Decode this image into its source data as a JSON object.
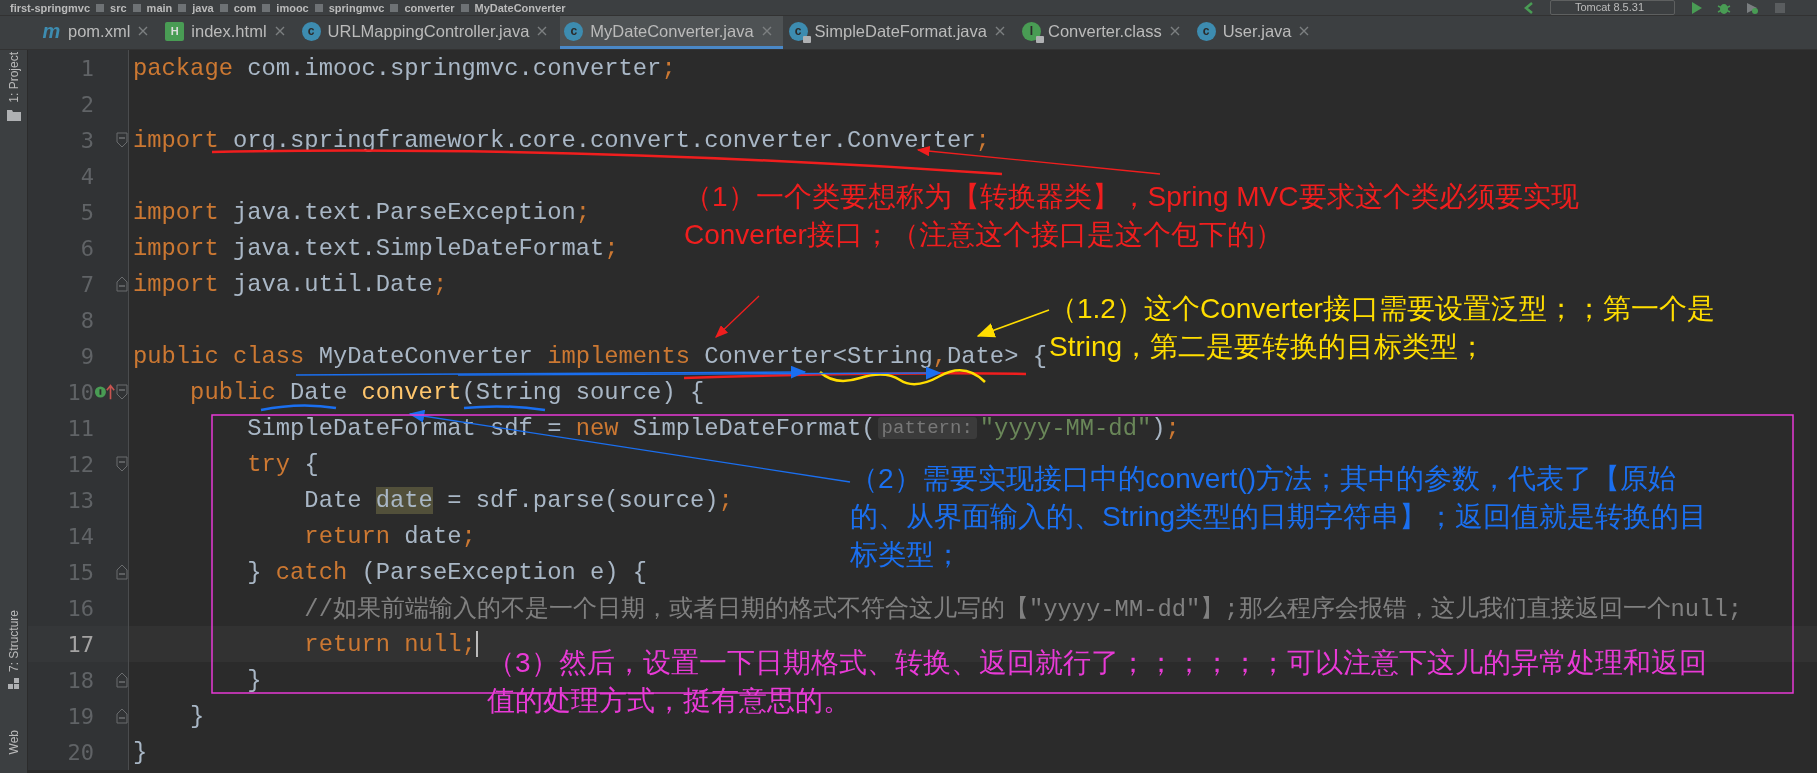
{
  "breadcrumbs": [
    "first-springmvc",
    "src",
    "main",
    "java",
    "com",
    "imooc",
    "springmvc",
    "converter",
    "MyDateConverter"
  ],
  "run_config": "Tomcat 8.5.31",
  "tabs": [
    {
      "label": "pom.xml",
      "badge": "m",
      "kind": "maven",
      "locked": false,
      "selected": false
    },
    {
      "label": "index.html",
      "badge": "H",
      "kind": "html",
      "locked": false,
      "selected": false
    },
    {
      "label": "URLMappingController.java",
      "badge": "c",
      "kind": "class",
      "locked": false,
      "selected": false
    },
    {
      "label": "MyDateConverter.java",
      "badge": "c",
      "kind": "class",
      "locked": false,
      "selected": true
    },
    {
      "label": "SimpleDateFormat.java",
      "badge": "c",
      "kind": "class",
      "locked": true,
      "selected": false
    },
    {
      "label": "Converter.class",
      "badge": "I",
      "kind": "interface",
      "locked": true,
      "selected": false
    },
    {
      "label": "User.java",
      "badge": "c",
      "kind": "class",
      "locked": false,
      "selected": false
    }
  ],
  "side_tools": [
    {
      "label": "1: Project",
      "kind": "project"
    },
    {
      "label": "7: Structure",
      "kind": "structure"
    },
    {
      "label": "Web",
      "kind": "web"
    }
  ],
  "lines": [
    {
      "n": "1",
      "current": false,
      "fold_start": false,
      "fold_end": false,
      "implements_marker": false,
      "segs": [
        {
          "kind": "keyword",
          "t": "package"
        },
        {
          "kind": "plain",
          "t": " com.imooc.springmvc.converter"
        },
        {
          "kind": "keyword",
          "t": ";"
        }
      ]
    },
    {
      "n": "2",
      "current": false,
      "fold_start": false,
      "fold_end": false,
      "implements_marker": false
    },
    {
      "n": "3",
      "current": false,
      "fold_start": true,
      "fold_end": false,
      "implements_marker": false,
      "segs": [
        {
          "kind": "keyword",
          "t": "import"
        },
        {
          "kind": "plain",
          "t": " org.springframework.core.convert.converter.Converter"
        },
        {
          "kind": "keyword",
          "t": ";"
        }
      ]
    },
    {
      "n": "4",
      "current": false,
      "fold_start": false,
      "fold_end": false,
      "implements_marker": false
    },
    {
      "n": "5",
      "current": false,
      "fold_start": false,
      "fold_end": false,
      "implements_marker": false,
      "segs": [
        {
          "kind": "keyword",
          "t": "import"
        },
        {
          "kind": "plain",
          "t": " java.text.ParseException"
        },
        {
          "kind": "keyword",
          "t": ";"
        }
      ]
    },
    {
      "n": "6",
      "current": false,
      "fold_start": false,
      "fold_end": false,
      "implements_marker": false,
      "segs": [
        {
          "kind": "keyword",
          "t": "import"
        },
        {
          "kind": "plain",
          "t": " java.text.SimpleDateFormat"
        },
        {
          "kind": "keyword",
          "t": ";"
        }
      ]
    },
    {
      "n": "7",
      "current": false,
      "fold_start": false,
      "fold_end": true,
      "implements_marker": false,
      "segs": [
        {
          "kind": "keyword",
          "t": "import"
        },
        {
          "kind": "plain",
          "t": " java.util.Date"
        },
        {
          "kind": "keyword",
          "t": ";"
        }
      ]
    },
    {
      "n": "8",
      "current": false,
      "fold_start": false,
      "fold_end": false,
      "implements_marker": false
    },
    {
      "n": "9",
      "current": false,
      "fold_start": false,
      "fold_end": false,
      "implements_marker": false,
      "segs": [
        {
          "kind": "keyword",
          "t": "public class "
        },
        {
          "kind": "plain",
          "t": "MyDateConverter "
        },
        {
          "kind": "keyword",
          "t": "implements "
        },
        {
          "kind": "plain",
          "t": "Converter<String"
        },
        {
          "kind": "keyword",
          "t": ","
        },
        {
          "kind": "plain",
          "t": "Date> {"
        }
      ]
    },
    {
      "n": "10",
      "current": false,
      "fold_start": true,
      "fold_end": false,
      "implements_marker": true,
      "segs": [
        {
          "kind": "keyword",
          "t": "    public "
        },
        {
          "kind": "plain",
          "t": "Date "
        },
        {
          "kind": "method",
          "t": "convert"
        },
        {
          "kind": "plain",
          "t": "(String source) {"
        }
      ]
    },
    {
      "n": "11",
      "current": false,
      "fold_start": false,
      "fold_end": false,
      "implements_marker": false,
      "segs": [
        {
          "kind": "plain",
          "t": "        SimpleDateFormat sdf = "
        },
        {
          "kind": "keyword",
          "t": "new "
        },
        {
          "kind": "plain",
          "t": "SimpleDateFormat("
        },
        {
          "kind": "hint",
          "t": "pattern:"
        },
        {
          "kind": "string",
          "t": "\"yyyy-MM-dd\""
        },
        {
          "kind": "plain",
          "t": ")"
        },
        {
          "kind": "keyword",
          "t": ";"
        }
      ]
    },
    {
      "n": "12",
      "current": false,
      "fold_start": true,
      "fold_end": false,
      "implements_marker": false,
      "segs": [
        {
          "kind": "keyword",
          "t": "        try "
        },
        {
          "kind": "plain",
          "t": "{"
        }
      ]
    },
    {
      "n": "13",
      "current": false,
      "fold_start": false,
      "fold_end": false,
      "implements_marker": false,
      "segs": [
        {
          "kind": "plain",
          "t": "            Date "
        },
        {
          "kind": "highlight",
          "t": "date"
        },
        {
          "kind": "plain",
          "t": " = sdf.parse(source)"
        },
        {
          "kind": "keyword",
          "t": ";"
        }
      ]
    },
    {
      "n": "14",
      "current": false,
      "fold_start": false,
      "fold_end": false,
      "implements_marker": false,
      "segs": [
        {
          "kind": "keyword",
          "t": "            return "
        },
        {
          "kind": "plain",
          "t": "date"
        },
        {
          "kind": "keyword",
          "t": ";"
        }
      ]
    },
    {
      "n": "15",
      "current": false,
      "fold_start": false,
      "fold_end": true,
      "implements_marker": false,
      "segs": [
        {
          "kind": "plain",
          "t": "        } "
        },
        {
          "kind": "keyword",
          "t": "catch "
        },
        {
          "kind": "plain",
          "t": "(ParseException e) {"
        }
      ]
    },
    {
      "n": "16",
      "current": false,
      "fold_start": false,
      "fold_end": false,
      "implements_marker": false,
      "segs": [
        {
          "kind": "comment",
          "t": "            //如果前端输入的不是一个日期，或者日期的格式不符合这儿写的【\"yyyy-MM-dd\"】;那么程序会报错，这儿我们直接返回一个null;"
        }
      ]
    },
    {
      "n": "17",
      "current": true,
      "fold_start": false,
      "fold_end": false,
      "implements_marker": false,
      "segs": [
        {
          "kind": "keyword",
          "t": "            return null;"
        }
      ]
    },
    {
      "n": "18",
      "current": false,
      "fold_start": false,
      "fold_end": true,
      "implements_marker": false,
      "segs": [
        {
          "kind": "plain",
          "t": "        }"
        }
      ]
    },
    {
      "n": "19",
      "current": false,
      "fold_start": false,
      "fold_end": true,
      "implements_marker": false,
      "segs": [
        {
          "kind": "plain",
          "t": "    }"
        }
      ]
    },
    {
      "n": "20",
      "current": false,
      "fold_start": false,
      "fold_end": false,
      "implements_marker": false,
      "segs": [
        {
          "kind": "plain",
          "t": "}"
        }
      ]
    }
  ],
  "annotations": [
    {
      "color": "#f01e1e",
      "text": "（1）一个类要想称为【转换器类】，Spring MVC要求这个类必须要实现Converter接口；（注意这个接口是这个包下的）"
    },
    {
      "color": "#ffdd00",
      "text": "（1.2）这个Converter接口需要设置泛型；；第一个是String，第二是要转换的目标类型；"
    },
    {
      "color": "#1a6ff0",
      "text": "（2）需要实现接口中的convert()方法；其中的参数，代表了【原始的、从界面输入的、String类型的日期字符串】；返回值就是转换的目标类型；"
    },
    {
      "color": "#e83ad6",
      "text": "（3）然后，设置一下日期格式、转换、返回就行了；；；；；；可以注意下这儿的异常处理和返回值的处理方式，挺有意思的。"
    }
  ]
}
